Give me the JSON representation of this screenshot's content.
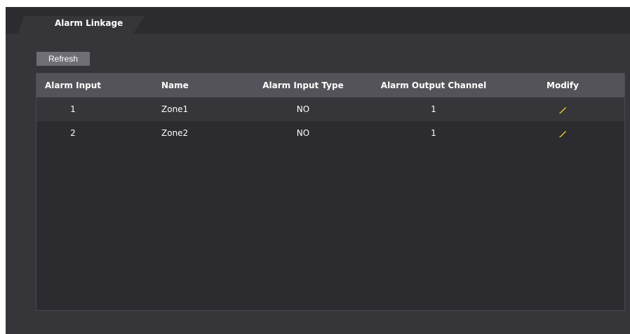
{
  "tab": {
    "label": "Alarm Linkage"
  },
  "toolbar": {
    "refresh_label": "Refresh"
  },
  "table": {
    "headers": [
      "Alarm Input",
      "Name",
      "Alarm Input Type",
      "Alarm Output Channel",
      "Modify"
    ],
    "rows": [
      {
        "input": "1",
        "name": "Zone1",
        "type": "NO",
        "output_channel": "1"
      },
      {
        "input": "2",
        "name": "Zone2",
        "type": "NO",
        "output_channel": "1"
      }
    ]
  },
  "icons": {
    "modify": "pencil-edit-icon"
  },
  "colors": {
    "edit_icon": "#e6d21a",
    "header_bg": "#545359",
    "panel_bg": "#36353a"
  }
}
